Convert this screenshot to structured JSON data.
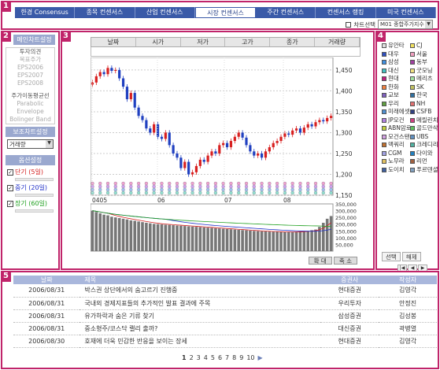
{
  "regions": [
    "1",
    "2",
    "3",
    "4",
    "5"
  ],
  "nav": {
    "tabs": [
      "한경 Consensus",
      "종목 컨센서스",
      "산업 컨센서스",
      "시장 컨센서스",
      "주간 컨센서스",
      "컨센서스 랭킹",
      "미국 컨센서스"
    ],
    "active_tab": 3,
    "chart_select_label": "차트선택",
    "chart_select_value": "M01 종합주가지수"
  },
  "sidebar": {
    "main_chart_title": "메인차트설정",
    "main_chart_items": [
      "투자의견",
      "목표주가",
      "EPS2006",
      "EPS2007",
      "EPS2008"
    ],
    "overlay_items": [
      "주가이동평균선",
      "Parabolic",
      "Envelope",
      "Bolinger Band"
    ],
    "sub_chart_title": "보조차트설정",
    "sub_chart_value": "거래량",
    "options_title": "옵션설정",
    "options": [
      {
        "label": "단기 (5일)",
        "color": "#d42020",
        "checked": true
      },
      {
        "label": "중기 (20일)",
        "color": "#2030c8",
        "checked": true
      },
      {
        "label": "장기 (60일)",
        "color": "#20a020",
        "checked": true
      }
    ]
  },
  "chart": {
    "ohlc_headers": [
      "날짜",
      "시가",
      "저가",
      "고가",
      "종가",
      "거래량"
    ],
    "buttons": [
      "확 대",
      "축 소"
    ]
  },
  "chart_data": {
    "type": "candlestick",
    "ylim": [
      1150,
      1480
    ],
    "y_ticks": [
      "1,450",
      "1,400",
      "1,350",
      "1,300",
      "1,250",
      "1,200",
      "1,150"
    ],
    "x_ticks": [
      "0405",
      "06",
      "07",
      "08"
    ],
    "volume_ticks": [
      "350,000",
      "300,000",
      "250,000",
      "200,000",
      "150,000",
      "100,000",
      "50,000"
    ],
    "volume_ylim": [
      0,
      350000
    ],
    "close_series": [
      1420,
      1435,
      1445,
      1440,
      1455,
      1448,
      1450,
      1430,
      1410,
      1380,
      1395,
      1360,
      1340,
      1330,
      1310,
      1300,
      1320,
      1290,
      1285,
      1300,
      1270,
      1250,
      1240,
      1215,
      1230,
      1200,
      1205,
      1220,
      1235,
      1230,
      1245,
      1255,
      1250,
      1270,
      1275,
      1265,
      1280,
      1290,
      1300,
      1288,
      1270,
      1255,
      1245,
      1250,
      1240,
      1255,
      1265,
      1275,
      1280,
      1290,
      1298,
      1295,
      1305,
      1310,
      1300,
      1312,
      1320,
      1315,
      1325,
      1330,
      1327,
      1335,
      1340
    ],
    "volume_series": [
      300000,
      290000,
      280000,
      270000,
      265000,
      255000,
      250000,
      245000,
      240000,
      235000,
      228000,
      225000,
      220000,
      215000,
      210000,
      206000,
      202000,
      200000,
      198000,
      196000,
      194000,
      192000,
      190000,
      188000,
      186000,
      184000,
      182000,
      180000,
      178000,
      176000,
      174000,
      172000,
      170000,
      168000,
      166000,
      164000,
      162000,
      160000,
      158000,
      156000,
      154000,
      152000,
      150000,
      148000,
      147000,
      146000,
      145000,
      144000,
      143000,
      142000,
      141000,
      140000,
      142000,
      144000,
      146000,
      148000,
      150000,
      155000,
      160000,
      180000,
      210000,
      240000,
      260000
    ]
  },
  "brokers": {
    "items": [
      {
        "name": "유안타",
        "color": "#e0e0e0"
      },
      {
        "name": "CJ",
        "color": "#f0e060"
      },
      {
        "name": "대우",
        "color": "#3050c0"
      },
      {
        "name": "서울",
        "color": "#f0a0c0"
      },
      {
        "name": "삼성",
        "color": "#4090e0"
      },
      {
        "name": "동부",
        "color": "#a040a0"
      },
      {
        "name": "대신",
        "color": "#40c0c0"
      },
      {
        "name": "굿모닝",
        "color": "#f0e080"
      },
      {
        "name": "현대",
        "color": "#c02080"
      },
      {
        "name": "메리츠",
        "color": "#a0e0a0"
      },
      {
        "name": "한화",
        "color": "#f08040"
      },
      {
        "name": "SK",
        "color": "#c0c060"
      },
      {
        "name": "교보",
        "color": "#8060c0"
      },
      {
        "name": "한국",
        "color": "#3070a0"
      },
      {
        "name": "우리",
        "color": "#60a040"
      },
      {
        "name": "NH",
        "color": "#e07070"
      },
      {
        "name": "미래에셋",
        "color": "#5090d0"
      },
      {
        "name": "CSFB",
        "color": "#304080"
      },
      {
        "name": "JP모건",
        "color": "#b080e0"
      },
      {
        "name": "메릴린치",
        "color": "#d04080"
      },
      {
        "name": "ABN암로",
        "color": "#c0d040"
      },
      {
        "name": "골드만삭스",
        "color": "#60c060"
      },
      {
        "name": "모건스탠리",
        "color": "#d0a0e0"
      },
      {
        "name": "UBS",
        "color": "#6090c0"
      },
      {
        "name": "맥쿼리",
        "color": "#c07030"
      },
      {
        "name": "크레디리요네",
        "color": "#50b0a0"
      },
      {
        "name": "CGM",
        "color": "#a0a0e0"
      },
      {
        "name": "다이와",
        "color": "#2080c0"
      },
      {
        "name": "노무라",
        "color": "#e0c060"
      },
      {
        "name": "리먼",
        "color": "#a06040"
      },
      {
        "name": "도이치",
        "color": "#4060a0"
      },
      {
        "name": "푸르덴셜",
        "color": "#80a0c0"
      }
    ],
    "select_label": "선택",
    "clear_label": "해제"
  },
  "news": {
    "headers": [
      "날짜",
      "제목",
      "증권사",
      "작성자"
    ],
    "rows": [
      {
        "date": "2006/08/31",
        "title": "박스권 상단에서의 숨고르기 진행중",
        "broker": "현대증권",
        "author": "김영각"
      },
      {
        "date": "2006/08/31",
        "title": "국내외 경제지표들의 추가적인 발표 결과에 주목",
        "broker": "우리투자",
        "author": "안정진"
      },
      {
        "date": "2006/08/31",
        "title": "유가하락과 숨은 기류 찾기",
        "broker": "삼성증권",
        "author": "김성봉"
      },
      {
        "date": "2006/08/31",
        "title": "중소형주/코스닥 랠리 출까?",
        "broker": "대신증권",
        "author": "곽병열"
      },
      {
        "date": "2006/08/30",
        "title": "호재에 더욱 민감한 반응을 보이는 장세",
        "broker": "현대증권",
        "author": "김영각"
      }
    ],
    "pages": [
      "1",
      "2",
      "3",
      "4",
      "5",
      "6",
      "7",
      "8",
      "9",
      "10"
    ],
    "next_label": "▶"
  }
}
